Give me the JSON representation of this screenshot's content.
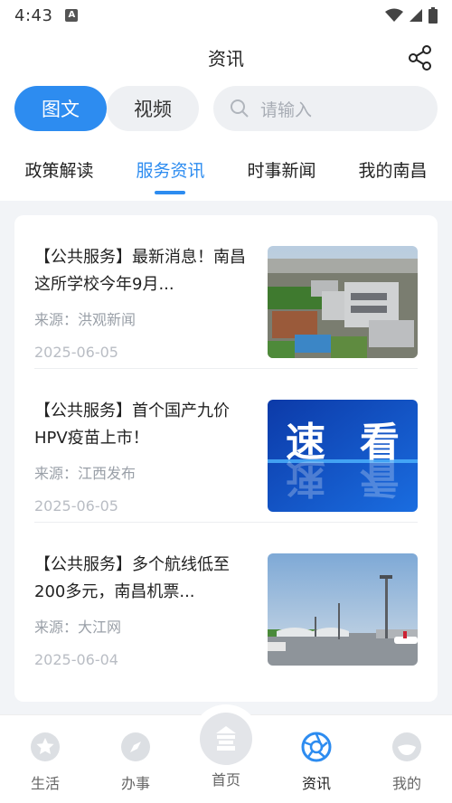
{
  "status": {
    "time": "4:43"
  },
  "header": {
    "title": "资讯"
  },
  "search_row": {
    "tabs": [
      {
        "label": "图文",
        "active": true
      },
      {
        "label": "视频",
        "active": false
      }
    ],
    "search_placeholder": "请输入"
  },
  "categories": [
    {
      "label": "政策解读",
      "active": false
    },
    {
      "label": "服务资讯",
      "active": true
    },
    {
      "label": "时事新闻",
      "active": false
    },
    {
      "label": "我的南昌",
      "active": false
    }
  ],
  "articles": [
    {
      "title": "【公共服务】最新消息！南昌这所学校今年9月...",
      "source": "来源：洪观新闻",
      "date": "2025-06-05",
      "thumb": "campus-aerial-photo"
    },
    {
      "title": "【公共服务】首个国产九价HPV疫苗上市！",
      "source": "来源：江西发布",
      "date": "2025-06-05",
      "thumb": "速看",
      "thumb_text": [
        "速",
        "看"
      ]
    },
    {
      "title": "【公共服务】多个航线低至200多元，南昌机票...",
      "source": "来源：大江网",
      "date": "2025-06-04",
      "thumb": "airport-photo"
    }
  ],
  "nav": [
    {
      "label": "生活",
      "icon": "star-icon"
    },
    {
      "label": "办事",
      "icon": "compass-icon"
    },
    {
      "label": "首页",
      "icon": "home-logo-icon"
    },
    {
      "label": "资讯",
      "icon": "aperture-icon",
      "active": true
    },
    {
      "label": "我的",
      "icon": "profile-icon"
    }
  ],
  "colors": {
    "accent": "#2d8cf0",
    "background": "#f2f4f7"
  }
}
